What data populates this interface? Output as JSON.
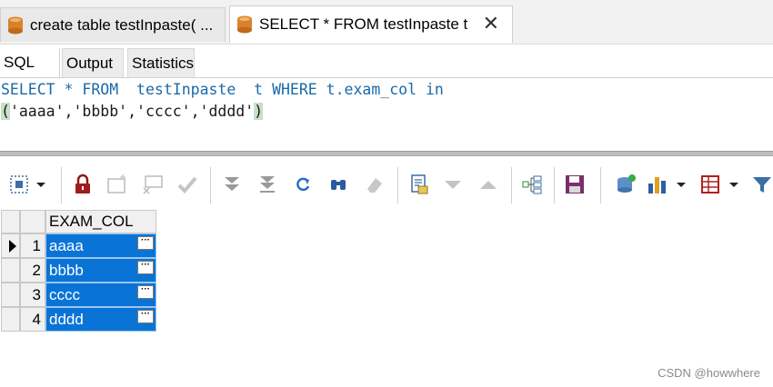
{
  "doc_tabs": [
    {
      "label": "create table testInpaste(  ..."
    },
    {
      "label": "SELECT * FROM testInpaste t"
    }
  ],
  "sub_tabs": [
    "SQL",
    "Output",
    "Statistics"
  ],
  "sql": {
    "line1": {
      "kw1": "SELECT",
      "mid1": " * ",
      "kw2": "FROM",
      "mid2": "  testInpaste  t ",
      "kw3": "WHERE",
      "mid3": " t.exam_col ",
      "kw4": "in"
    },
    "line2": {
      "open": "(",
      "list": "'aaaa','bbbb','cccc','dddd'",
      "close": ")"
    }
  },
  "grid": {
    "column": "EXAM_COL",
    "rows": [
      {
        "n": "1",
        "v": "aaaa"
      },
      {
        "n": "2",
        "v": "bbbb"
      },
      {
        "n": "3",
        "v": "cccc"
      },
      {
        "n": "4",
        "v": "dddd"
      }
    ],
    "cell_button": "···"
  },
  "icons": [
    "select-cells-icon",
    "lock-icon",
    "insert-record-icon",
    "delete-record-icon",
    "post-edit-icon",
    "first-record-icon",
    "last-record-icon",
    "refresh-icon",
    "find-icon",
    "clear-icon",
    "record-view-icon",
    "filter-down-icon",
    "filter-up-icon",
    "query-tree-icon",
    "save-icon",
    "export-db-icon",
    "chart-icon",
    "table-grid-icon",
    "filter-icon"
  ],
  "watermark": "CSDN @howwhere",
  "colors": {
    "selection": "#0a74d6",
    "keyword": "#1a6aa8",
    "paren_highlight": "#c7e0c7"
  }
}
